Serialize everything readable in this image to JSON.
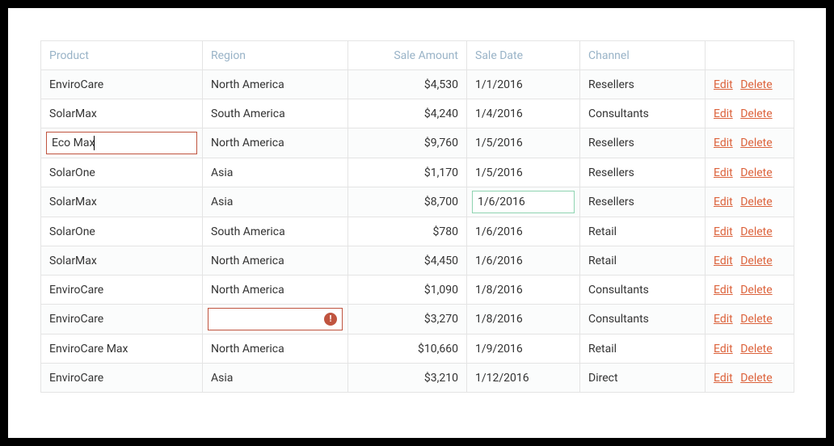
{
  "columns": {
    "product": "Product",
    "region": "Region",
    "amount": "Sale Amount",
    "date": "Sale Date",
    "channel": "Channel"
  },
  "actions": {
    "edit": "Edit",
    "delete": "Delete"
  },
  "editing_value": "Eco Max",
  "error_icon_glyph": "!",
  "rows": [
    {
      "product": "EnviroCare",
      "region": "North America",
      "amount": "$4,530",
      "date": "1/1/2016",
      "channel": "Resellers"
    },
    {
      "product": "SolarMax",
      "region": "South America",
      "amount": "$4,240",
      "date": "1/4/2016",
      "channel": "Consultants"
    },
    {
      "product": "",
      "region": "North America",
      "amount": "$9,760",
      "date": "1/5/2016",
      "channel": "Resellers"
    },
    {
      "product": "SolarOne",
      "region": "Asia",
      "amount": "$1,170",
      "date": "1/5/2016",
      "channel": "Resellers"
    },
    {
      "product": "SolarMax",
      "region": "Asia",
      "amount": "$8,700",
      "date": "1/6/2016",
      "channel": "Resellers"
    },
    {
      "product": "SolarOne",
      "region": "South America",
      "amount": "$780",
      "date": "1/6/2016",
      "channel": "Retail"
    },
    {
      "product": "SolarMax",
      "region": "North America",
      "amount": "$4,450",
      "date": "1/6/2016",
      "channel": "Retail"
    },
    {
      "product": "EnviroCare",
      "region": "North America",
      "amount": "$1,090",
      "date": "1/8/2016",
      "channel": "Consultants"
    },
    {
      "product": "EnviroCare",
      "region": "",
      "amount": "$3,270",
      "date": "1/8/2016",
      "channel": "Consultants"
    },
    {
      "product": "EnviroCare Max",
      "region": "North America",
      "amount": "$10,660",
      "date": "1/9/2016",
      "channel": "Retail"
    },
    {
      "product": "EnviroCare",
      "region": "Asia",
      "amount": "$3,210",
      "date": "1/12/2016",
      "channel": "Direct"
    }
  ]
}
